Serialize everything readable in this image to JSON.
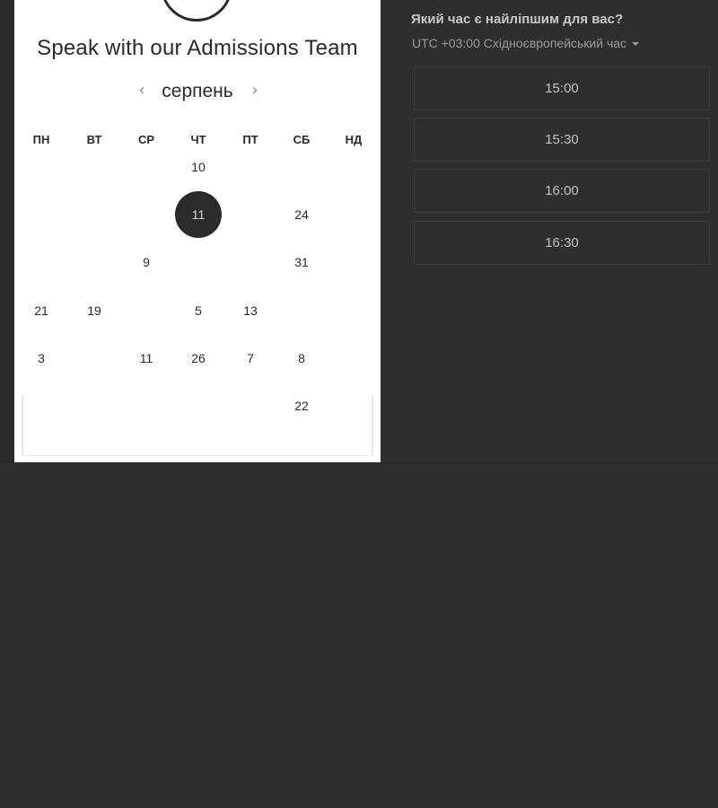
{
  "card": {
    "title": "Speak with our Admissions Team",
    "month": "серпень",
    "prev_icon": "chevron-left-icon",
    "next_icon": "chevron-right-icon"
  },
  "weekdays": [
    "ПН",
    "ВТ",
    "СР",
    "ЧТ",
    "ПТ",
    "СБ",
    "НД"
  ],
  "days": [
    {
      "label": "10",
      "row": 0,
      "col": 3,
      "selected": false
    },
    {
      "label": "11",
      "row": 1,
      "col": 3,
      "selected": true
    },
    {
      "label": "24",
      "row": 1,
      "col": 5,
      "selected": false
    },
    {
      "label": "9",
      "row": 2,
      "col": 2,
      "selected": false
    },
    {
      "label": "31",
      "row": 2,
      "col": 5,
      "selected": false
    },
    {
      "label": "21",
      "row": 3,
      "col": 0,
      "selected": false
    },
    {
      "label": "19",
      "row": 3,
      "col": 1,
      "selected": false
    },
    {
      "label": "5",
      "row": 3,
      "col": 3,
      "selected": false
    },
    {
      "label": "13",
      "row": 3,
      "col": 4,
      "selected": false
    },
    {
      "label": "3",
      "row": 4,
      "col": 0,
      "selected": false
    },
    {
      "label": "11",
      "row": 4,
      "col": 2,
      "selected": false
    },
    {
      "label": "26",
      "row": 4,
      "col": 3,
      "selected": false
    },
    {
      "label": "7",
      "row": 4,
      "col": 4,
      "selected": false
    },
    {
      "label": "8",
      "row": 4,
      "col": 5,
      "selected": false
    },
    {
      "label": "22",
      "row": 5,
      "col": 5,
      "selected": false
    }
  ],
  "panel": {
    "question": "Який час є найліпшим для вас?",
    "timezone": "UTC +03:00 Східноєвропейський час",
    "slots": [
      "15:00",
      "15:30",
      "16:00",
      "16:30"
    ]
  },
  "colors": {
    "background": "#2e2e2e",
    "card": "#ffffff",
    "selected_day": "#2b2b2b",
    "slot_border": "#3d3d3d",
    "text_light": "#c4c4c4"
  }
}
